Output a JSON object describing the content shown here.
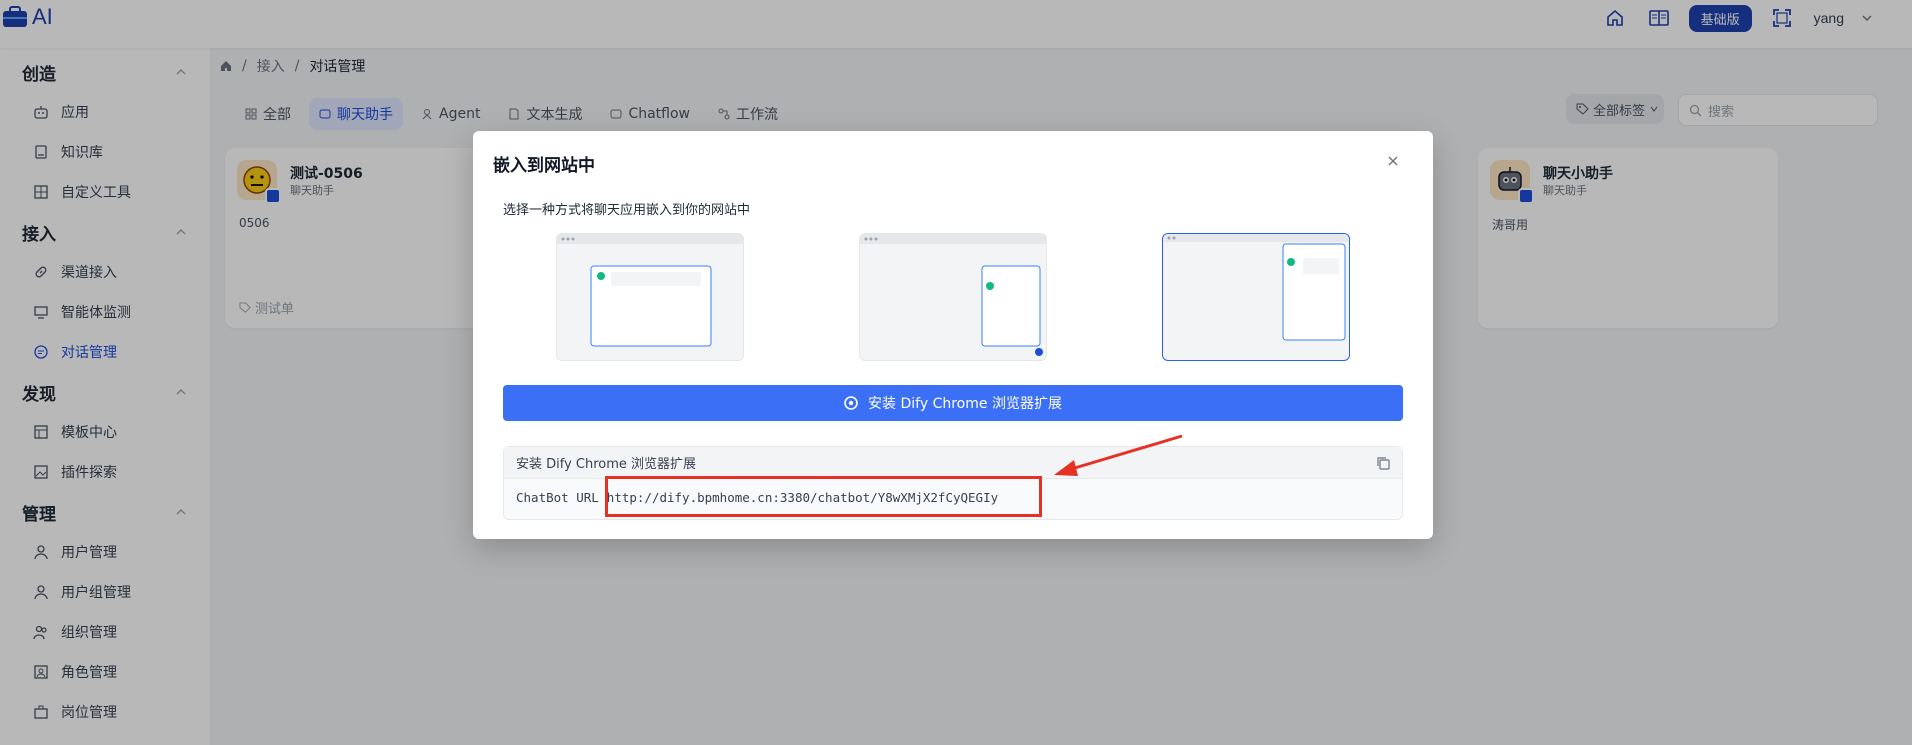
{
  "app": {
    "logo_text": "AI",
    "plan_badge": "基础版",
    "username": "yang"
  },
  "sidebar": {
    "groups": [
      {
        "title": "创造",
        "items": [
          {
            "label": "应用"
          },
          {
            "label": "知识库"
          },
          {
            "label": "自定义工具"
          }
        ]
      },
      {
        "title": "接入",
        "items": [
          {
            "label": "渠道接入"
          },
          {
            "label": "智能体监测"
          },
          {
            "label": "对话管理"
          }
        ]
      },
      {
        "title": "发现",
        "items": [
          {
            "label": "模板中心"
          },
          {
            "label": "插件探索"
          }
        ]
      },
      {
        "title": "管理",
        "items": [
          {
            "label": "用户管理"
          },
          {
            "label": "用户组管理"
          },
          {
            "label": "组织管理"
          },
          {
            "label": "角色管理"
          },
          {
            "label": "岗位管理"
          }
        ]
      }
    ]
  },
  "breadcrumb": {
    "sep": "/",
    "items": [
      "接入",
      "对话管理"
    ]
  },
  "tabs": [
    "全部",
    "聊天助手",
    "Agent",
    "文本生成",
    "Chatflow",
    "工作流"
  ],
  "filters": {
    "tag_label": "全部标签",
    "search_placeholder": "搜索"
  },
  "cards": [
    {
      "title": "测试-0506",
      "subtitle": "聊天助手",
      "desc": "0506",
      "tag": "测试单"
    },
    {
      "title": "聊天小助手",
      "subtitle": "聊天助手",
      "desc": "涛哥用"
    }
  ],
  "modal": {
    "title": "嵌入到网站中",
    "desc": "选择一种方式将聊天应用嵌入到你的网站中",
    "install_button": "安装 Dify Chrome 浏览器扩展",
    "code_header": "安装 Dify Chrome 浏览器扩展",
    "code_label": "ChatBot URL",
    "code_url": "http://dify.bpmhome.cn:3380/chatbot/Y8wXMjX2fCyQEGIy",
    "selected_option": 3
  },
  "colors": {
    "accent": "#1d4ed8",
    "button": "#3b6ff5",
    "annotation": "#e53224"
  }
}
